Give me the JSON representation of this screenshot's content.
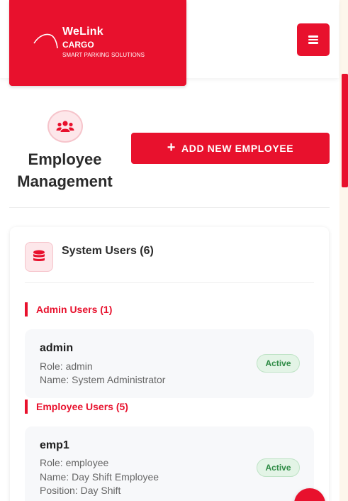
{
  "brand": {
    "name": "WeLink",
    "sub": "CARGO",
    "tagline": "SMART PARKING SOLUTIONS",
    "accent": "#e8112d"
  },
  "header": {
    "menu_icon": "hamburger-icon"
  },
  "page": {
    "title_icon": "users-icon",
    "title": "Employee Management",
    "add_button_label": "ADD NEW EMPLOYEE",
    "add_button_icon": "plus-icon"
  },
  "card": {
    "icon": "database-icon",
    "title": "System Users (6)",
    "groups": [
      {
        "label": "Admin Users (1)",
        "users": [
          {
            "username": "admin",
            "role": "Role: admin",
            "name": "Name: System Administrator",
            "status": "Active"
          }
        ]
      },
      {
        "label": "Employee Users (5)",
        "users": [
          {
            "username": "emp1",
            "role": "Role: employee",
            "name": "Name: Day Shift Employee",
            "position": "Position: Day Shift",
            "status": "Active"
          }
        ]
      }
    ]
  },
  "colors": {
    "active_badge_bg": "#e3f4e6",
    "active_badge_text": "#2e8b45"
  }
}
